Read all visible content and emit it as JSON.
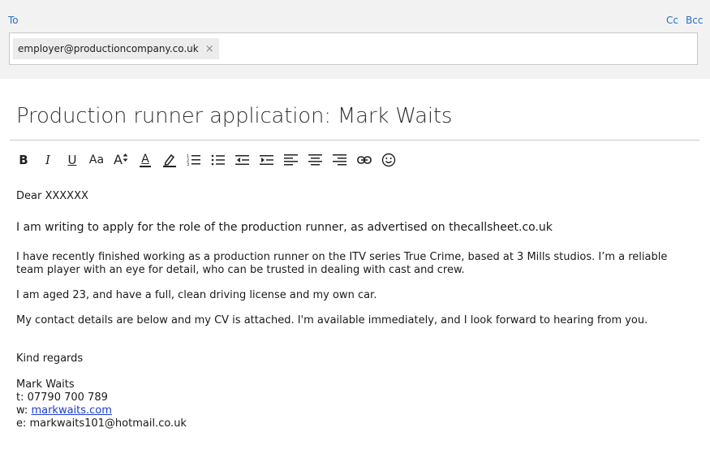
{
  "compose": {
    "to_label": "To",
    "cc_label": "Cc",
    "bcc_label": "Bcc",
    "recipients": [
      {
        "email": "employer@productioncompany.co.uk",
        "remove_glyph": "×"
      }
    ],
    "subject": "Production runner application: Mark Waits"
  },
  "toolbar": {
    "buttons": [
      {
        "name": "bold",
        "glyph": "B"
      },
      {
        "name": "italic",
        "glyph": "I"
      },
      {
        "name": "underline",
        "glyph": "U"
      },
      {
        "name": "font-size",
        "glyph": "Aa"
      },
      {
        "name": "grow-font",
        "glyph": "A"
      },
      {
        "name": "font-color",
        "glyph": "A"
      },
      {
        "name": "highlight"
      },
      {
        "name": "numbered-list"
      },
      {
        "name": "bulleted-list"
      },
      {
        "name": "decrease-indent"
      },
      {
        "name": "increase-indent"
      },
      {
        "name": "align-left"
      },
      {
        "name": "align-center"
      },
      {
        "name": "align-right"
      },
      {
        "name": "insert-link"
      },
      {
        "name": "emoji"
      }
    ],
    "accent_colors": {
      "font_color_bar": "#222222",
      "highlight_bar": "#222222"
    }
  },
  "body": {
    "greeting": "Dear XXXXXX",
    "intro": "I am writing to apply for the role of the production runner, as advertised on thecallsheet.co.uk",
    "para1": "I have recently finished working as a production runner on the ITV series True Crime, based at 3 Mills studios. I’m a reliable team player with an eye for detail, who can be trusted in dealing with cast and crew.",
    "para2": "I am aged 23, and have a full, clean driving license and my own car.",
    "para3": "My contact details are below and my CV is attached. I'm available immediately, and I look forward to hearing from you.",
    "signoff": "Kind regards",
    "signature": {
      "name": "Mark Waits",
      "phone_prefix": "t: ",
      "phone": "07790 700 789",
      "web_prefix": "w: ",
      "web": "markwaits.com",
      "email_prefix": "e: ",
      "email": "markwaits101@hotmail.co.uk"
    }
  },
  "colors": {
    "link_blue": "#2a6fc4",
    "header_bg": "#f2f2f2",
    "hyperlink": "#1a3ccf"
  }
}
